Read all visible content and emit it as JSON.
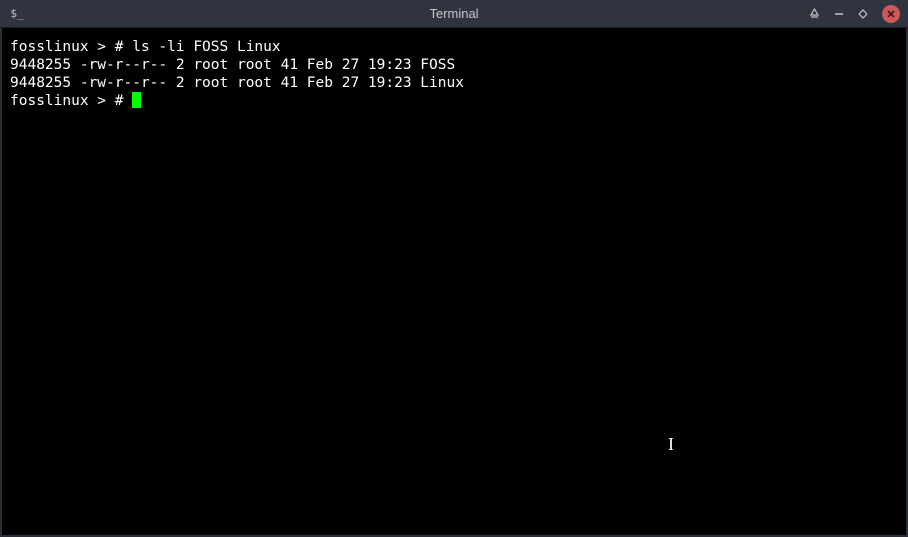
{
  "titlebar": {
    "app_icon_label": "$_",
    "title": "Terminal"
  },
  "terminal": {
    "lines": [
      {
        "prompt": "fosslinux > # ",
        "command": "ls -li FOSS Linux"
      },
      {
        "output": "9448255 -rw-r--r-- 2 root root 41 Feb 27 19:23 FOSS"
      },
      {
        "output": "9448255 -rw-r--r-- 2 root root 41 Feb 27 19:23 Linux"
      },
      {
        "prompt": "fosslinux > # ",
        "command": ""
      }
    ]
  }
}
